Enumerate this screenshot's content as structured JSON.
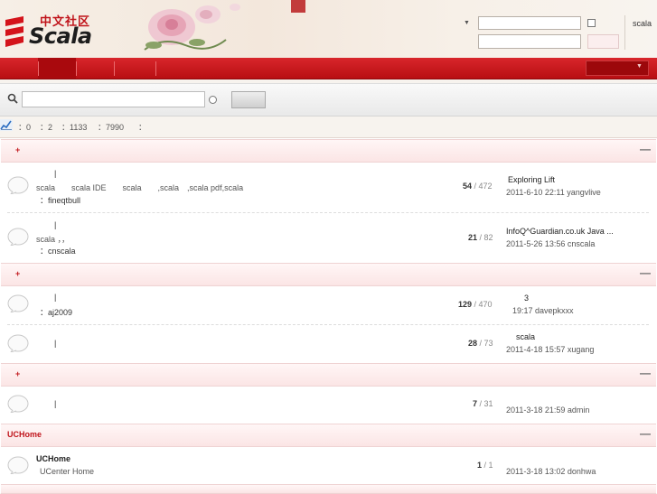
{
  "header": {
    "logo_cn": "中文社区",
    "logo_scala": "Scala",
    "link": "scala",
    "login_arrow": "▼"
  },
  "stats": [
    "：0",
    "：2",
    "：1133",
    "：7990",
    "："
  ],
  "categories": [
    {
      "star": "+",
      "title": "",
      "forums": [
        {
          "sep": "|",
          "desc": "scala　　scala IDE　　scala　　,scala　,scala pdf,scala",
          "mod": "：fineqtbull",
          "threads": "54",
          "posts": "/ 472",
          "last_title": "Exploring Lift",
          "last_meta": "2011-6-10 22:11 yangvlive"
        },
        {
          "sep": "|",
          "desc": "scala ，，",
          "mod": "：cnscala",
          "threads": "21",
          "posts": "/ 82",
          "last_title": "InfoQ^Guardian.co.uk Java ...",
          "last_meta": "2011-5-26 13:56 cnscala"
        }
      ]
    },
    {
      "star": "+",
      "title": "",
      "forums": [
        {
          "sep": "|",
          "desc": "",
          "mod": "：aj2009",
          "threads": "129",
          "posts": "/ 470",
          "last_title": "3",
          "last_meta": "19:17 davepkxxx"
        },
        {
          "sep": "|",
          "desc": "",
          "mod": "",
          "threads": "28",
          "posts": "/ 73",
          "last_title": "scala",
          "last_meta": "2011-4-18 15:57 xugang"
        }
      ]
    },
    {
      "star": "+",
      "title": "",
      "forums": [
        {
          "sep": "|",
          "desc": "",
          "mod": "",
          "threads": "7",
          "posts": "/ 31",
          "last_title": "",
          "last_meta": "2011-3-18 21:59 admin"
        }
      ]
    },
    {
      "star": "",
      "title": "UCHome",
      "forums": [
        {
          "title": "UCHome",
          "desc": "UCenter Home",
          "mod": "",
          "threads": "1",
          "posts": "/ 1",
          "last_title": "",
          "last_meta": "2011-3-18 13:02 donhwa"
        }
      ]
    }
  ],
  "collapse_glyph": "—",
  "colors": {
    "brand_red": "#c0141b",
    "nav_red": "#b80e12"
  }
}
